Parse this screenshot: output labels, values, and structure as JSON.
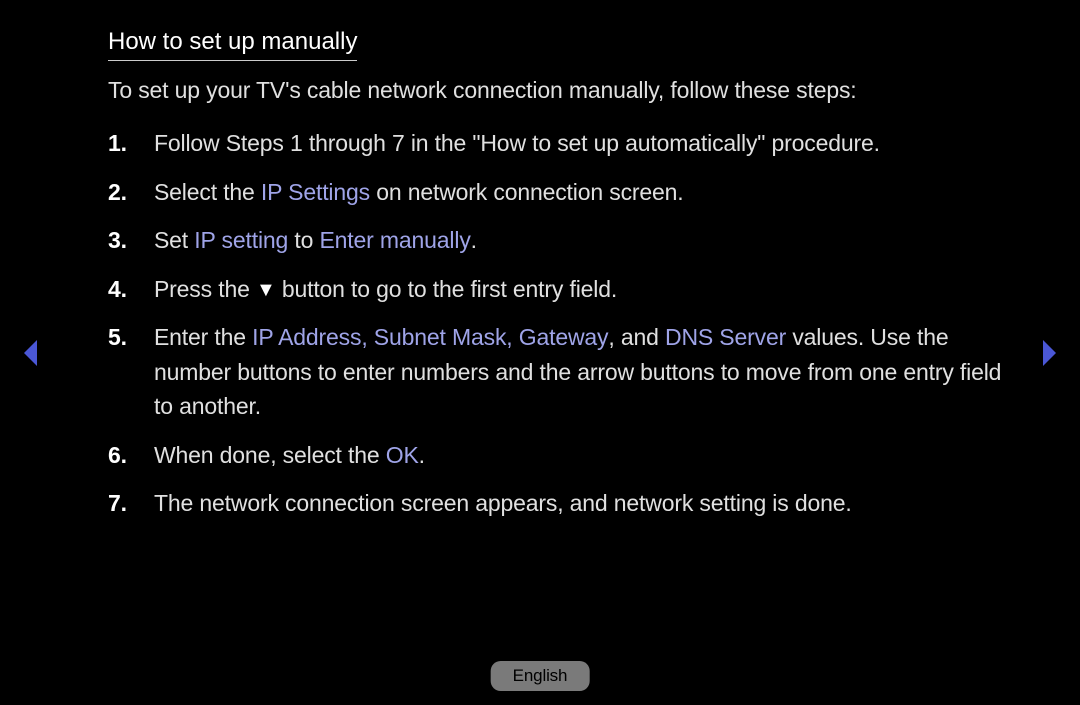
{
  "title": "How to set up manually",
  "intro": "To set up your TV's cable network connection manually, follow these steps:",
  "steps": {
    "s1": {
      "num": "1.",
      "a": "Follow Steps 1 through 7 in the \"How to set up automatically\" procedure."
    },
    "s2": {
      "num": "2.",
      "a": "Select the ",
      "b": "IP Settings",
      "c": " on network connection screen."
    },
    "s3": {
      "num": "3.",
      "a": "Set ",
      "b": "IP setting",
      "c": " to ",
      "d": "Enter manually",
      "e": "."
    },
    "s4": {
      "num": "4.",
      "a": "Press the ",
      "c": " button to go to the first entry field."
    },
    "s5": {
      "num": "5.",
      "a": "Enter the ",
      "b": "IP Address, Subnet Mask, Gateway",
      "c": ", and ",
      "d": "DNS Server",
      "e": " values. Use the number buttons to enter numbers and the arrow buttons to move from one entry field to another."
    },
    "s6": {
      "num": "6.",
      "a": "When done, select the ",
      "b": "OK",
      "c": "."
    },
    "s7": {
      "num": "7.",
      "a": "The network connection screen appears, and network setting is done."
    }
  },
  "language": "English"
}
